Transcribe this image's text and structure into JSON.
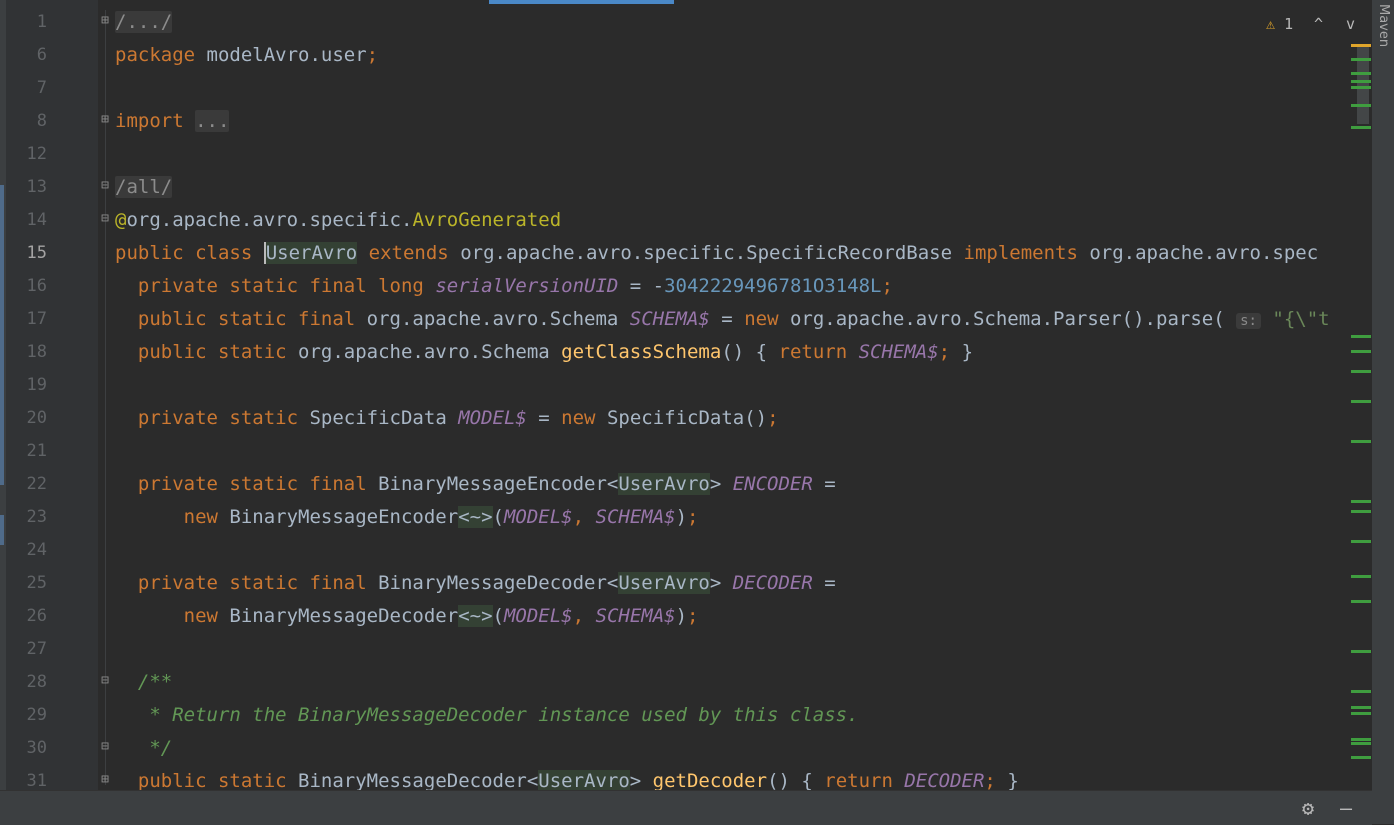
{
  "editor": {
    "lines": [
      {
        "number": "1",
        "fold": "⊞",
        "tokens": [
          {
            "c": "folded",
            "t": "/.../"
          }
        ]
      },
      {
        "number": "6",
        "fold": "",
        "tokens": [
          {
            "c": "kw",
            "t": "package "
          },
          {
            "c": "",
            "t": "modelAvro.user"
          },
          {
            "c": "kw",
            "t": ";"
          }
        ]
      },
      {
        "number": "7",
        "fold": "",
        "tokens": []
      },
      {
        "number": "8",
        "fold": "⊞",
        "tokens": [
          {
            "c": "kw",
            "t": "import "
          },
          {
            "c": "folded",
            "t": "..."
          }
        ]
      },
      {
        "number": "12",
        "fold": "",
        "tokens": []
      },
      {
        "number": "13",
        "fold": "⊟",
        "tokens": [
          {
            "c": "folded",
            "t": "/all/"
          }
        ]
      },
      {
        "number": "14",
        "fold": "⊟",
        "tokens": [
          {
            "c": "ann",
            "t": "@"
          },
          {
            "c": "",
            "t": "org.apache.avro.specific."
          },
          {
            "c": "ann",
            "t": "AvroGenerated"
          }
        ]
      },
      {
        "number": "15",
        "fold": "",
        "current": true,
        "tokens": [
          {
            "c": "kw",
            "t": "public class "
          },
          {
            "c": "hl caret",
            "t": "UserAvro"
          },
          {
            "c": "kw",
            "t": " extends "
          },
          {
            "c": "",
            "t": "org.apache.avro.specific.SpecificRecordBase"
          },
          {
            "c": "kw",
            "t": " implements "
          },
          {
            "c": "",
            "t": "org.apache.avro.spec"
          }
        ]
      },
      {
        "number": "16",
        "fold": "",
        "tokens": [
          {
            "c": "",
            "t": "  "
          },
          {
            "c": "kw",
            "t": "private static final long "
          },
          {
            "c": "sfield",
            "t": "serialVersionUID"
          },
          {
            "c": "",
            "t": " = -"
          },
          {
            "c": "num",
            "t": "3042229496781O3148L"
          },
          {
            "c": "kw",
            "t": ";"
          }
        ]
      },
      {
        "number": "17",
        "fold": "",
        "tokens": [
          {
            "c": "",
            "t": "  "
          },
          {
            "c": "kw",
            "t": "public static final "
          },
          {
            "c": "",
            "t": "org.apache.avro.Schema "
          },
          {
            "c": "sfield",
            "t": "SCHEMA$"
          },
          {
            "c": "",
            "t": " = "
          },
          {
            "c": "kw",
            "t": "new "
          },
          {
            "c": "",
            "t": "org.apache.avro.Schema.Parser().parse( "
          },
          {
            "c": "hint",
            "t": "s:"
          },
          {
            "c": "",
            "t": " "
          },
          {
            "c": "str",
            "t": "\"{\\\"t"
          }
        ]
      },
      {
        "number": "18",
        "fold": "",
        "tokens": [
          {
            "c": "",
            "t": "  "
          },
          {
            "c": "kw",
            "t": "public static "
          },
          {
            "c": "",
            "t": "org.apache.avro.Schema "
          },
          {
            "c": "fn",
            "t": "getClassSchema"
          },
          {
            "c": "",
            "t": "() { "
          },
          {
            "c": "kw",
            "t": "return "
          },
          {
            "c": "sfield",
            "t": "SCHEMA$"
          },
          {
            "c": "kw",
            "t": ";"
          },
          {
            "c": "",
            "t": " }"
          }
        ]
      },
      {
        "number": "19",
        "fold": "",
        "tokens": []
      },
      {
        "number": "20",
        "fold": "",
        "tokens": [
          {
            "c": "",
            "t": "  "
          },
          {
            "c": "kw",
            "t": "private static "
          },
          {
            "c": "",
            "t": "SpecificData "
          },
          {
            "c": "sfield",
            "t": "MODEL$"
          },
          {
            "c": "",
            "t": " = "
          },
          {
            "c": "kw",
            "t": "new "
          },
          {
            "c": "",
            "t": "SpecificData()"
          },
          {
            "c": "kw",
            "t": ";"
          }
        ]
      },
      {
        "number": "21",
        "fold": "",
        "tokens": []
      },
      {
        "number": "22",
        "fold": "",
        "tokens": [
          {
            "c": "",
            "t": "  "
          },
          {
            "c": "kw",
            "t": "private static final "
          },
          {
            "c": "",
            "t": "BinaryMessageEncoder<"
          },
          {
            "c": "hl",
            "t": "UserAvro"
          },
          {
            "c": "",
            "t": "> "
          },
          {
            "c": "sfield",
            "t": "ENCODER"
          },
          {
            "c": "",
            "t": " ="
          }
        ]
      },
      {
        "number": "23",
        "fold": "",
        "tokens": [
          {
            "c": "",
            "t": "      "
          },
          {
            "c": "kw",
            "t": "new "
          },
          {
            "c": "",
            "t": "BinaryMessageEncoder"
          },
          {
            "c": "hl",
            "t": "<~>"
          },
          {
            "c": "",
            "t": "("
          },
          {
            "c": "sfield",
            "t": "MODEL$"
          },
          {
            "c": "kw",
            "t": ", "
          },
          {
            "c": "sfield",
            "t": "SCHEMA$"
          },
          {
            "c": "",
            "t": ")"
          },
          {
            "c": "kw",
            "t": ";"
          }
        ]
      },
      {
        "number": "24",
        "fold": "",
        "tokens": []
      },
      {
        "number": "25",
        "fold": "",
        "tokens": [
          {
            "c": "",
            "t": "  "
          },
          {
            "c": "kw",
            "t": "private static final "
          },
          {
            "c": "",
            "t": "BinaryMessageDecoder<"
          },
          {
            "c": "hl",
            "t": "UserAvro"
          },
          {
            "c": "",
            "t": "> "
          },
          {
            "c": "sfield",
            "t": "DECODER"
          },
          {
            "c": "",
            "t": " ="
          }
        ]
      },
      {
        "number": "26",
        "fold": "",
        "tokens": [
          {
            "c": "",
            "t": "      "
          },
          {
            "c": "kw",
            "t": "new "
          },
          {
            "c": "",
            "t": "BinaryMessageDecoder"
          },
          {
            "c": "hl",
            "t": "<~>"
          },
          {
            "c": "",
            "t": "("
          },
          {
            "c": "sfield",
            "t": "MODEL$"
          },
          {
            "c": "kw",
            "t": ", "
          },
          {
            "c": "sfield",
            "t": "SCHEMA$"
          },
          {
            "c": "",
            "t": ")"
          },
          {
            "c": "kw",
            "t": ";"
          }
        ]
      },
      {
        "number": "27",
        "fold": "",
        "tokens": []
      },
      {
        "number": "28",
        "fold": "⊟",
        "tokens": [
          {
            "c": "",
            "t": "  "
          },
          {
            "c": "cmt",
            "t": "/**"
          }
        ]
      },
      {
        "number": "29",
        "fold": "",
        "tokens": [
          {
            "c": "",
            "t": "   "
          },
          {
            "c": "cmt",
            "t": "* Return the BinaryMessageDecoder instance used by this class."
          }
        ]
      },
      {
        "number": "30",
        "fold": "⊟",
        "tokens": [
          {
            "c": "",
            "t": "   "
          },
          {
            "c": "cmt",
            "t": "*/"
          }
        ]
      },
      {
        "number": "31",
        "fold": "⊞",
        "tokens": [
          {
            "c": "",
            "t": "  "
          },
          {
            "c": "kw",
            "t": "public static "
          },
          {
            "c": "",
            "t": "BinaryMessageDecoder<"
          },
          {
            "c": "hl",
            "t": "UserAvro"
          },
          {
            "c": "",
            "t": "> "
          },
          {
            "c": "fn",
            "t": "getDecoder"
          },
          {
            "c": "",
            "t": "() { "
          },
          {
            "c": "kw",
            "t": "return "
          },
          {
            "c": "sfield",
            "t": "DECODER"
          },
          {
            "c": "kw",
            "t": ";"
          },
          {
            "c": "",
            "t": " }"
          }
        ]
      }
    ]
  },
  "inspection": {
    "warning_icon": "warning-triangle-icon",
    "warning_count": "1",
    "prev_icon": "chevron-up-icon",
    "next_icon": "chevron-down-icon",
    "prev_glyph": "^",
    "next_glyph": "v"
  },
  "sidebar_right": {
    "maven_label": "Maven"
  },
  "statusbar": {
    "settings_icon": "gear-icon",
    "settings_glyph": "⚙",
    "minimize_icon": "minimize-icon",
    "minimize_glyph": "—"
  },
  "colors": {
    "background": "#2b2b2b",
    "keyword": "#cc7832",
    "annotation": "#bbb529",
    "number": "#6897bb",
    "static_field": "#9876aa",
    "method": "#ffc66d",
    "comment": "#629755",
    "warning": "#e0a52b"
  }
}
